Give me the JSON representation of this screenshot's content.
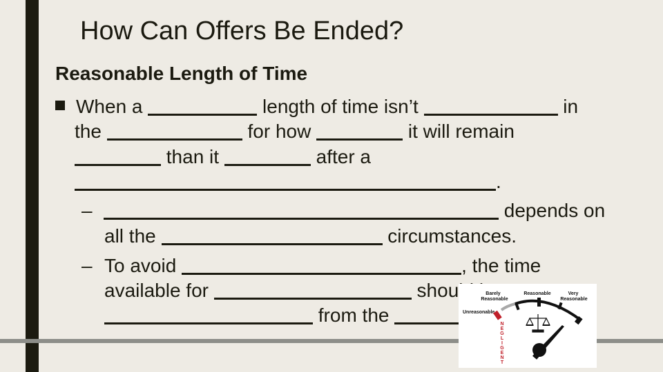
{
  "slide": {
    "title": "How Can Offers Be Ended?",
    "subheading": "Reasonable Length of Time",
    "bullet": {
      "icon": "square-bullet-icon",
      "lines": [
        {
          "parts": [
            "When a ",
            "",
            " length of time isn’t ",
            "",
            " in"
          ]
        },
        {
          "parts": [
            "the ",
            "",
            " for how ",
            "",
            " it will remain"
          ]
        },
        {
          "parts": [
            "",
            " than it ",
            "",
            " after a"
          ]
        },
        {
          "parts": [
            "",
            "."
          ]
        }
      ]
    },
    "sub_bullets": [
      {
        "marker": "–",
        "lines": [
          {
            "parts": [
              "",
              " depends on"
            ]
          },
          {
            "parts": [
              "all the ",
              "",
              " circumstances."
            ]
          }
        ]
      },
      {
        "marker": "–",
        "lines": [
          {
            "parts": [
              "To avoid ",
              "",
              ", the time"
            ]
          },
          {
            "parts": [
              "available for ",
              "",
              " should be"
            ]
          },
          {
            "parts": [
              "",
              " from the ",
              ""
            ]
          }
        ]
      }
    ]
  },
  "gauge_image": {
    "icon": "reasonableness-gauge-icon",
    "labels": {
      "unreasonable": "Unreasonable",
      "barely_line1": "Barely",
      "barely_line2": "Reasonable",
      "reasonable": "Reasonable",
      "very_line1": "Very",
      "very_line2": "Reasonable",
      "negligent": "NEGLIGENT"
    },
    "colors": {
      "negligent": "#c0202a",
      "barely": "#a8a8a8",
      "arc": "#111111"
    }
  }
}
